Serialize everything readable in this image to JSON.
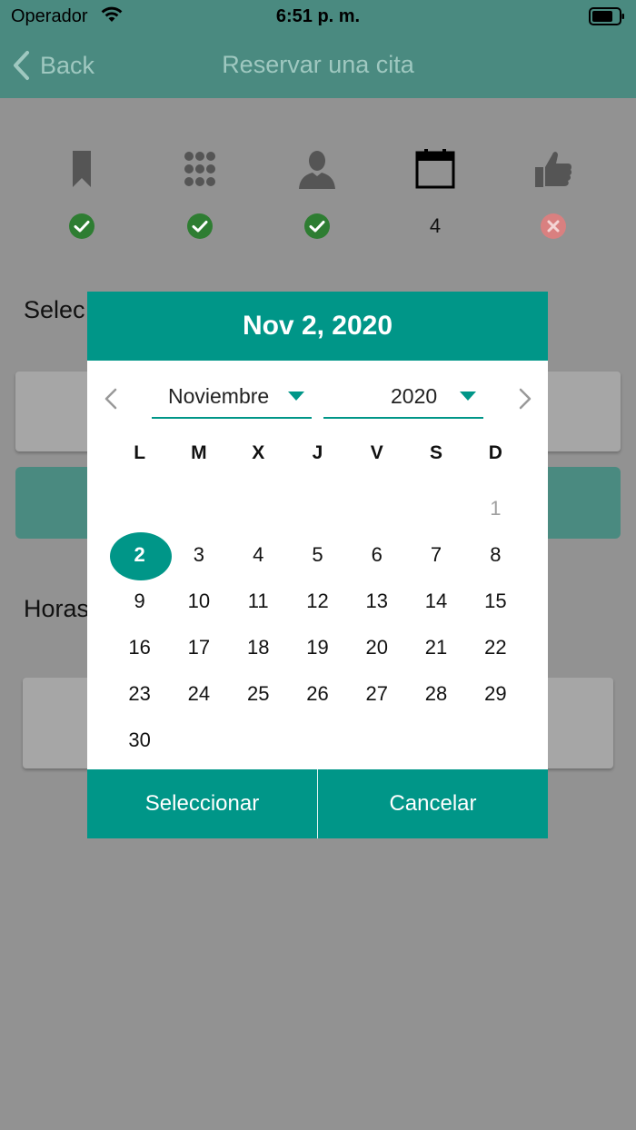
{
  "status_bar": {
    "carrier": "Operador",
    "time": "6:51 p. m.",
    "wifi_icon": "wifi-icon",
    "battery_icon": "battery-icon"
  },
  "nav": {
    "back_label": "Back",
    "title": "Reservar una cita"
  },
  "steps": [
    {
      "icon": "bookmark-icon",
      "status": "done"
    },
    {
      "icon": "grid-icon",
      "status": "done"
    },
    {
      "icon": "person-icon",
      "status": "done"
    },
    {
      "icon": "calendar-icon",
      "status": "current",
      "number": "4"
    },
    {
      "icon": "thumbs-up-icon",
      "status": "error"
    }
  ],
  "form": {
    "select_label_partial": "Selec",
    "horas_label_partial": "Horas"
  },
  "date_picker": {
    "header": "Nov 2, 2020",
    "month": "Noviembre",
    "year": "2020",
    "weekdays": [
      "L",
      "M",
      "X",
      "J",
      "V",
      "S",
      "D"
    ],
    "weeks": [
      [
        "",
        "",
        "",
        "",
        "",
        "",
        "1"
      ],
      [
        "2",
        "3",
        "4",
        "5",
        "6",
        "7",
        "8"
      ],
      [
        "9",
        "10",
        "11",
        "12",
        "13",
        "14",
        "15"
      ],
      [
        "16",
        "17",
        "18",
        "19",
        "20",
        "21",
        "22"
      ],
      [
        "23",
        "24",
        "25",
        "26",
        "27",
        "28",
        "29"
      ],
      [
        "30",
        "",
        "",
        "",
        "",
        "",
        ""
      ]
    ],
    "selected_day": "2",
    "muted_days": [
      "1"
    ],
    "select_label": "Seleccionar",
    "cancel_label": "Cancelar"
  },
  "colors": {
    "accent": "#009688",
    "nav_bg": "#4a8a80",
    "done": "#2e7d32",
    "error": "#d98080"
  }
}
